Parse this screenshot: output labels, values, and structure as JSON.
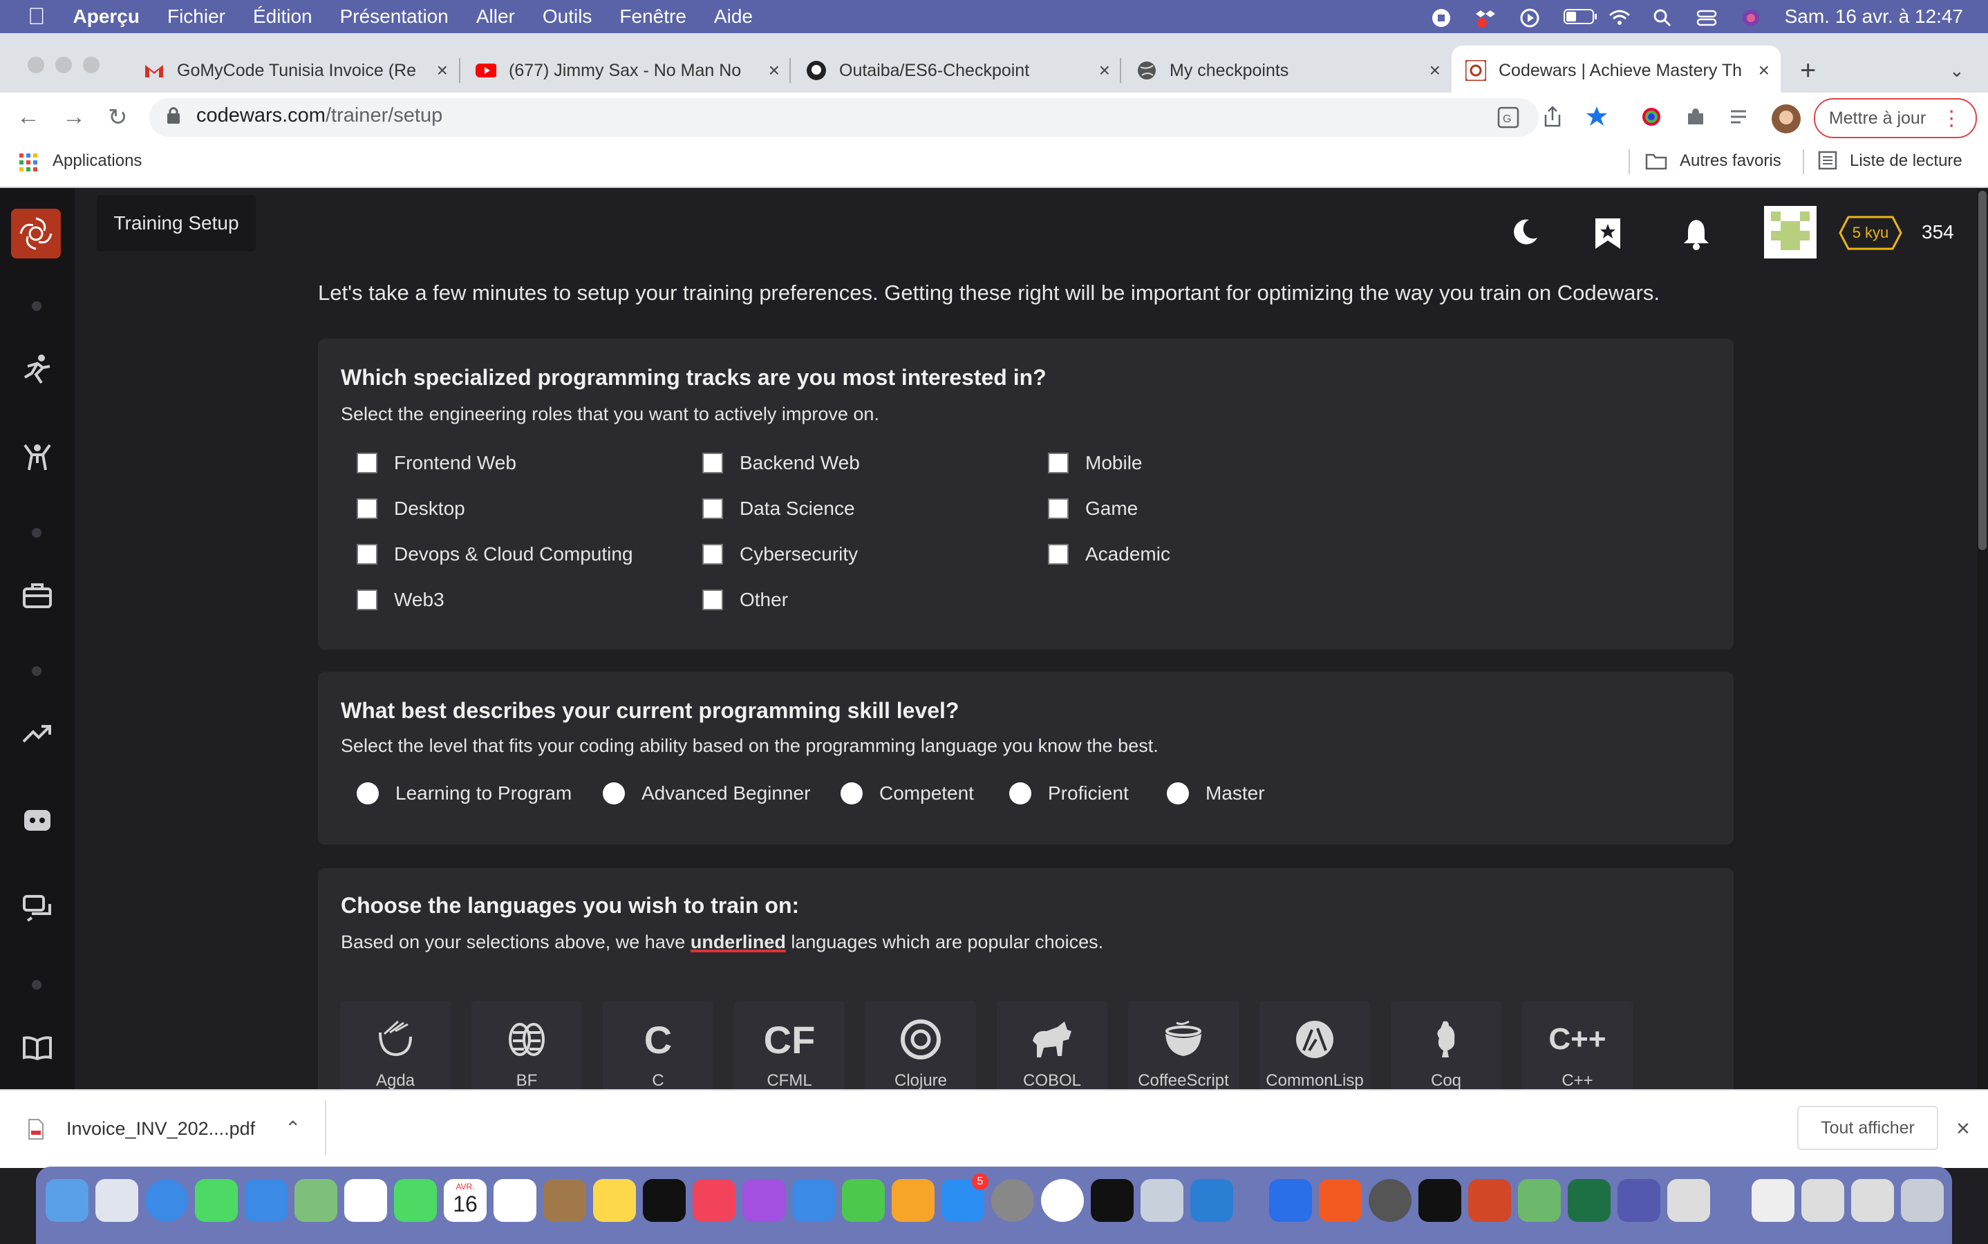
{
  "menubar": {
    "app": "Aperçu",
    "items": [
      "Fichier",
      "Édition",
      "Présentation",
      "Aller",
      "Outils",
      "Fenêtre",
      "Aide"
    ],
    "clock": "Sam. 16 avr. à  12:47"
  },
  "tabs": [
    {
      "title": "GoMyCode Tunisia Invoice (Re",
      "icon": "gmail-icon"
    },
    {
      "title": "(677) Jimmy Sax - No Man No",
      "icon": "youtube-icon"
    },
    {
      "title": "Outaiba/ES6-Checkpoint",
      "icon": "github-icon"
    },
    {
      "title": "My checkpoints",
      "icon": "globe-icon"
    },
    {
      "title": "Codewars | Achieve Mastery Th",
      "icon": "codewars-icon"
    }
  ],
  "url": {
    "host": "codewars.com",
    "path": "/trainer/setup"
  },
  "update_button": "Mettre à jour",
  "bookmarks": {
    "apps": "Applications",
    "other": "Autres favoris",
    "reading": "Liste de lecture"
  },
  "header": {
    "title": "Training Setup",
    "rank": "5 kyu",
    "honor": "354"
  },
  "intro": "Let's take a few minutes to setup your training preferences. Getting these right will be important for optimizing the way you train on Codewars.",
  "tracks": {
    "title": "Which specialized programming tracks are you most interested in?",
    "subtitle": "Select the engineering roles that you want to actively improve on.",
    "options": [
      "Frontend Web",
      "Backend Web",
      "Mobile",
      "Desktop",
      "Data Science",
      "Game",
      "Devops & Cloud Computing",
      "Cybersecurity",
      "Academic",
      "Web3",
      "Other"
    ]
  },
  "skill": {
    "title": "What best describes your current programming skill level?",
    "subtitle": "Select the level that fits your coding ability based on the programming language you know the best.",
    "options": [
      "Learning to Program",
      "Advanced Beginner",
      "Competent",
      "Proficient",
      "Master"
    ]
  },
  "languages": {
    "title": "Choose the languages you wish to train on:",
    "subtitle_pre": "Based on your selections above, we have ",
    "subtitle_emph": "underlined",
    "subtitle_post": " languages which are popular choices.",
    "items": [
      {
        "name": "Agda",
        "glyph": ""
      },
      {
        "name": "BF",
        "glyph": ""
      },
      {
        "name": "C",
        "glyph": "C"
      },
      {
        "name": "CFML",
        "glyph": "CF"
      },
      {
        "name": "Clojure",
        "glyph": ""
      },
      {
        "name": "COBOL",
        "glyph": ""
      },
      {
        "name": "CoffeeScript",
        "glyph": ""
      },
      {
        "name": "CommonLisp",
        "glyph": ""
      },
      {
        "name": "Coq",
        "glyph": ""
      },
      {
        "name": "C++",
        "glyph": "C++"
      }
    ]
  },
  "download": {
    "file": "Invoice_INV_202....pdf",
    "show_all": "Tout afficher"
  },
  "dock": {
    "calendar_month": "AVR.",
    "calendar_day": "16",
    "appstore_badge": "5"
  },
  "colors": {
    "codewars_red": "#b1361e",
    "rank_yellow": "#ecb613",
    "dark_bg": "#1f1f23",
    "card_bg": "#2a2a2f"
  }
}
